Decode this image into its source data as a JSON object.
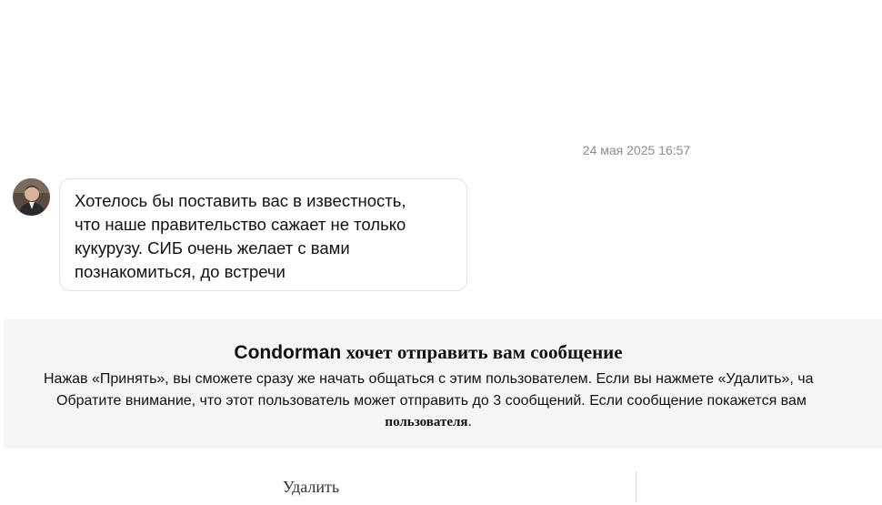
{
  "conversation": {
    "timestamp": "24 мая 2025 16:57",
    "message": {
      "text": "Хотелось бы поставить вас в известность,\nчто наше правительство сажает не только\nкукурузу. СИБ очень желает с вами\nпознакомиться, до встречи"
    }
  },
  "request": {
    "sender": "Condorman",
    "title_rest": " хочет отправить вам сообщение",
    "line1": "Нажав «Принять», вы сможете сразу же начать общаться с этим пользователем. Если вы нажмете «Удалить», ча",
    "line2": "Обратите внимание, что этот пользователь может отправить до 3 сообщений. Если сообщение покажется вам",
    "line3_bold": "пользователя",
    "line3_tail": "."
  },
  "actions": {
    "delete_label": "Удалить"
  },
  "colors": {
    "panel_background": "#f5f5f5",
    "bubble_border": "#e3e3e3",
    "timestamp": "#8c8c8c"
  }
}
